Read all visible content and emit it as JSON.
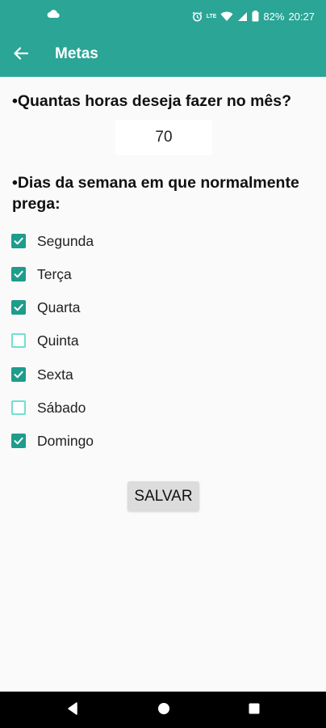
{
  "status_bar": {
    "battery": "82%",
    "time": "20:27",
    "network_label": "LTE",
    "icons": [
      "cloud-icon",
      "alarm-icon",
      "wifi-icon",
      "signal-icon",
      "battery-icon"
    ]
  },
  "app_bar": {
    "title": "Metas",
    "back_icon": "arrow-back-icon",
    "color": "#2aa596"
  },
  "goals": {
    "hours_question": "•Quantas horas deseja fazer no mês?",
    "hours_value": "70",
    "days_question": "•Dias da semana em que normalmente prega:",
    "days": [
      {
        "label": "Segunda",
        "checked": true
      },
      {
        "label": "Terça",
        "checked": true
      },
      {
        "label": "Quarta",
        "checked": true
      },
      {
        "label": "Quinta",
        "checked": false
      },
      {
        "label": "Sexta",
        "checked": true
      },
      {
        "label": "Sábado",
        "checked": false
      },
      {
        "label": "Domingo",
        "checked": true
      }
    ],
    "save_label": "SALVAR"
  },
  "nav_bar": {
    "icons": [
      "back-triangle-icon",
      "home-circle-icon",
      "recents-square-icon"
    ]
  }
}
